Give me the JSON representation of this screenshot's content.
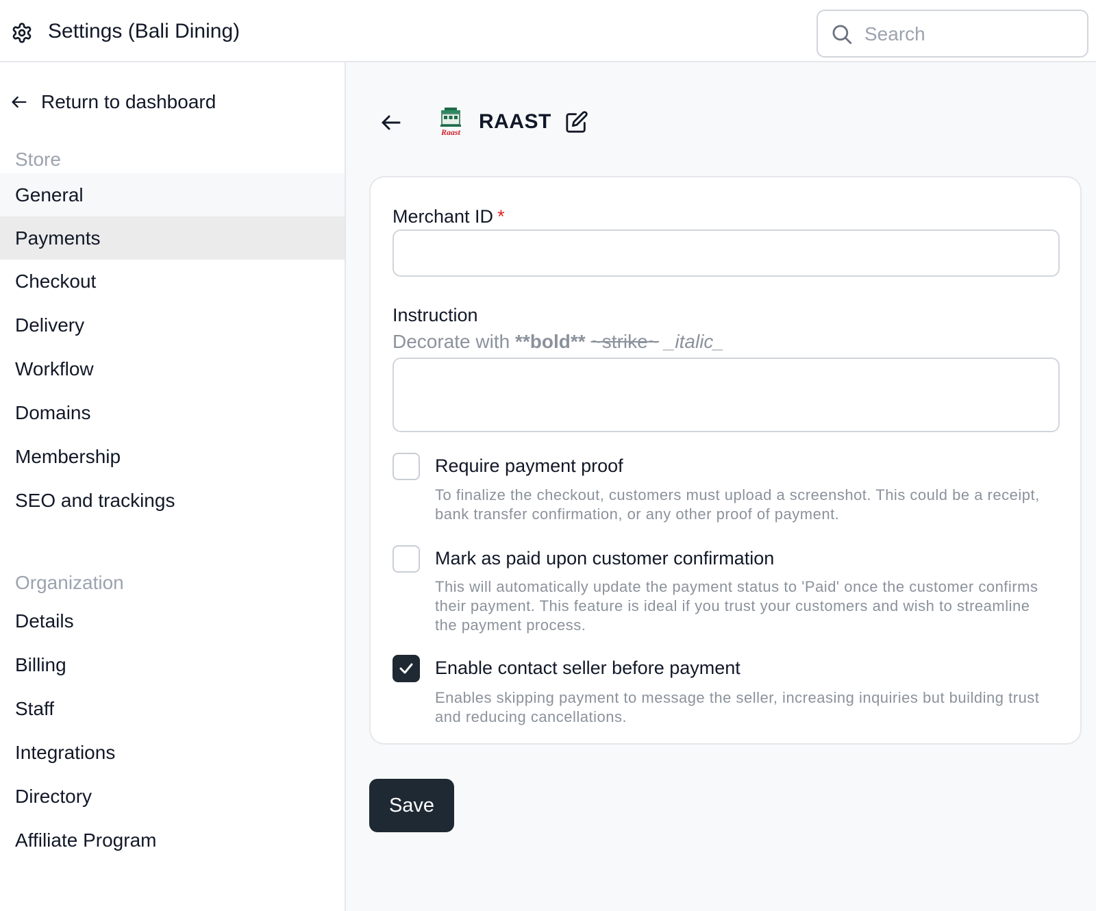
{
  "header": {
    "title": "Settings (Bali Dining)",
    "icon": "gear-icon",
    "search": {
      "placeholder": "Search",
      "value": ""
    }
  },
  "sidebar": {
    "return_label": "Return to dashboard",
    "store_section": "Store",
    "store_items": [
      "General",
      "Payments",
      "Checkout",
      "Delivery",
      "Workflow",
      "Domains",
      "Membership",
      "SEO and trackings"
    ],
    "active_item": "Payments",
    "organization_section": "Organization",
    "organization_items": [
      "Details",
      "Billing",
      "Staff",
      "Integrations",
      "Directory",
      "Affiliate Program"
    ]
  },
  "payment_method": {
    "name": "RAAST",
    "logo_text": "Raast",
    "fields": {
      "merchant_id": {
        "label": "Merchant ID",
        "required_mark": "*",
        "value": ""
      },
      "instruction": {
        "label": "Instruction",
        "hint_prefix": "Decorate with ",
        "hint_bold": "**bold**",
        "hint_strike": "~strike~",
        "hint_italic": "_italic_",
        "value": ""
      }
    },
    "options": [
      {
        "title": "Require payment proof",
        "description": "To finalize the checkout, customers must upload a screenshot. This could be a receipt, bank transfer confirmation, or any other proof of payment.",
        "checked": false
      },
      {
        "title": "Mark as paid upon customer confirmation",
        "description": "This will automatically update the payment status to 'Paid' once the customer confirms their payment. This feature is ideal if you trust your customers and wish to streamline the payment process.",
        "checked": false
      },
      {
        "title": "Enable contact seller before payment",
        "description": "Enables skipping payment to message the seller, increasing inquiries but building trust and reducing cancellations.",
        "checked": true
      }
    ],
    "save_label": "Save"
  },
  "colors": {
    "primary_button": "#1f2933",
    "required": "#dc2626",
    "muted_text": "#8b929c",
    "active_nav_bg": "#ebebeb"
  }
}
